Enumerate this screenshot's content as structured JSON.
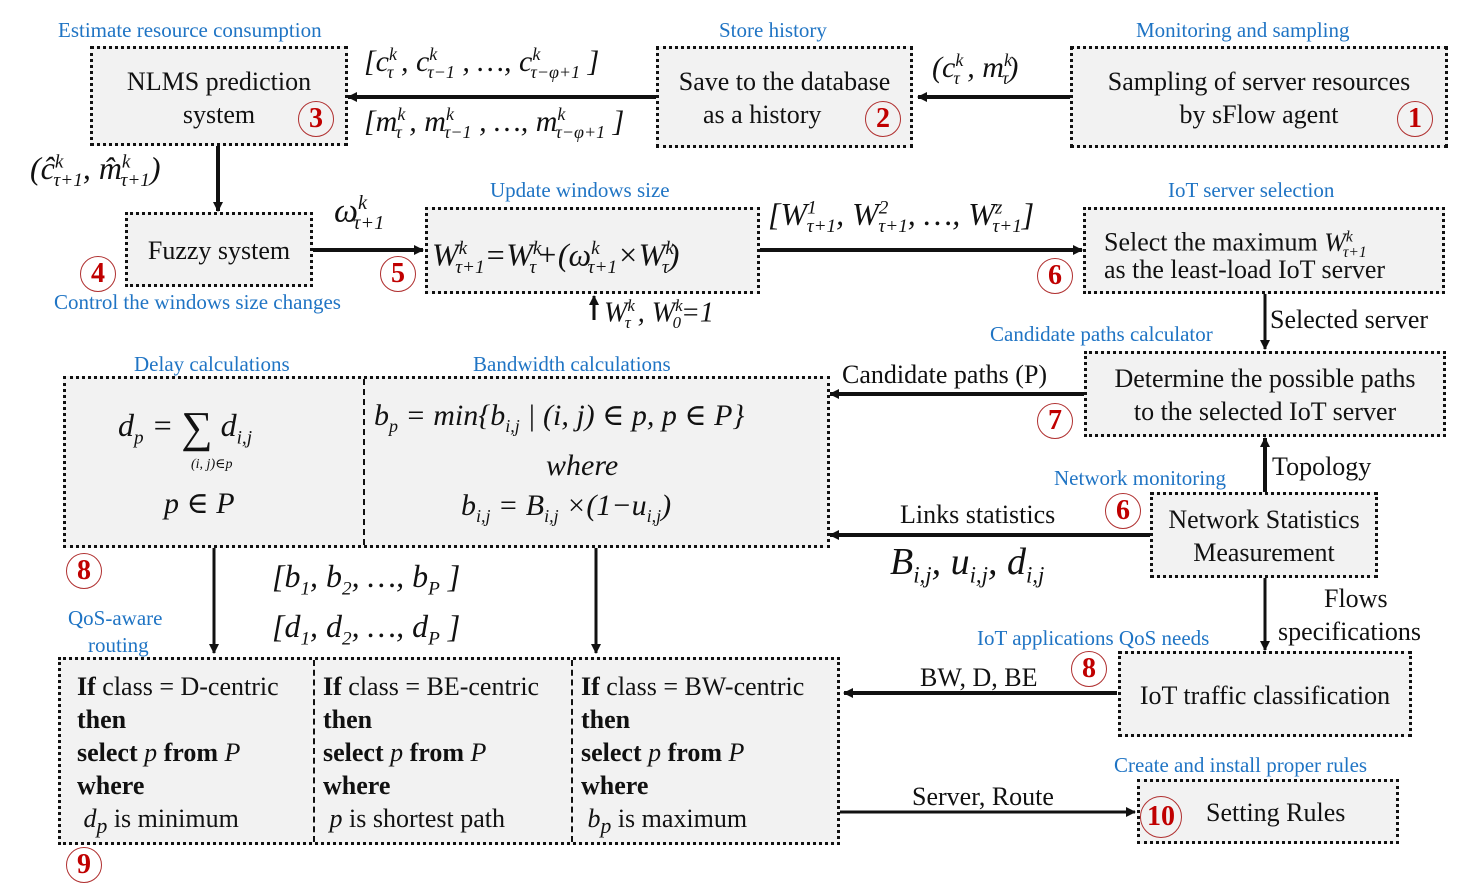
{
  "steps": {
    "s1": {
      "section": "Monitoring and sampling",
      "line1": "Sampling of server resources",
      "line2": "by sFlow agent",
      "badge": "1"
    },
    "s2": {
      "section": "Store history",
      "line1": "Save to the database",
      "line2": "as a history",
      "badge": "2"
    },
    "s3": {
      "section": "Estimate resource consumption",
      "line1": "NLMS prediction",
      "line2": "system",
      "badge": "3"
    },
    "s4": {
      "section": "Control the windows size changes",
      "line1": "Fuzzy system",
      "badge": "4"
    },
    "s5": {
      "section": "Update windows size",
      "formula": "W(τ+1)^k = W(τ)^k + (ω(τ+1)^k × W(τ)^k)",
      "badge": "5"
    },
    "s6a": {
      "section": "IoT server selection",
      "line1": "Select the maximum",
      "line2": "as the least-load IoT server",
      "badge": "6"
    },
    "s7": {
      "section": "Candidate paths calculator",
      "line1": "Determine the possible paths",
      "line2": "to the selected IoT server",
      "badge": "7"
    },
    "s6b": {
      "section": "Network monitoring",
      "line1": "Network Statistics",
      "line2": "Measurement",
      "badge": "6"
    },
    "s8a": {
      "section_delay": "Delay calculations",
      "section_bw": "Bandwidth calculations",
      "badge": "8",
      "delay_formula": "d_p = Σ_(i,j)∈p d_i,j",
      "delay_domain": "p ∈ P",
      "bw_formula": "b_p = min{b_i,j | (i,j) ∈ p, p ∈ P}",
      "bw_where": "where",
      "bw_link": "b_i,j = B_i,j × (1 − u_i,j)"
    },
    "s8b": {
      "section": "IoT applications QoS needs",
      "line1": "IoT traffic classification",
      "badge": "8"
    },
    "s9": {
      "section_line1": "QoS-aware",
      "section_line2": "routing",
      "badge": "9",
      "rules": [
        {
          "if": "If",
          "cond": " class = D-centric",
          "then": "then",
          "select_a": "select ",
          "select_p": "p",
          "select_b": " from ",
          "select_P": "P",
          "where": "where",
          "var": "d",
          "var_sub": "p",
          "result": " is minimum"
        },
        {
          "if": "If",
          "cond": " class = BE-centric",
          "then": "then",
          "select_a": "select ",
          "select_p": "p",
          "select_b": " from ",
          "select_P": "P",
          "where": "where",
          "var": "p",
          "var_sub": "",
          "result": " is shortest path"
        },
        {
          "if": "If",
          "cond": " class = BW-centric",
          "then": "then",
          "select_a": "select ",
          "select_p": "p",
          "select_b": " from ",
          "select_P": "P",
          "where": "where",
          "var": "b",
          "var_sub": "p",
          "result": " is maximum"
        }
      ]
    },
    "s10": {
      "section": "Create and install proper rules",
      "line1": "Setting Rules",
      "badge": "10"
    }
  },
  "edges": {
    "e1_2": "(c_τ^k , m_τ^k)",
    "e2_3_top": "[c_τ^k , c_τ−1^k , …, c_τ−φ+1^k]",
    "e2_3_bottom": "[m_τ^k , m_τ−1^k , …, m_τ−φ+1^k]",
    "e3_4": "(ĉ_τ+1^k , m̂_τ+1^k)",
    "e4_5": "ω_τ+1^k",
    "e5_input": "W_τ^k , W_0^k = 1",
    "e5_6": "[W_τ+1^1 , W_τ+1^2 , …, W_τ+1^z]",
    "e6_7": "Selected server",
    "e7_8": "Candidate paths (P)",
    "e_topology": "Topology",
    "e_links": "Links statistics",
    "e_links_vars": "B_i,j , u_i,j , d_i,j",
    "e_flows_line1": "Flows",
    "e_flows_line2": "specifications",
    "e8_9_b": "[b_1 , b_2 , …, b_P]",
    "e8_9_d": "[d_1 , d_2 , …, d_P]",
    "e_classes": "BW, D, BE",
    "e9_10": "Server, Route"
  },
  "colors": {
    "section_label": "#1f74c4",
    "badge": "#c00000",
    "box_fill": "#f2f2f2",
    "stroke": "#111111"
  }
}
